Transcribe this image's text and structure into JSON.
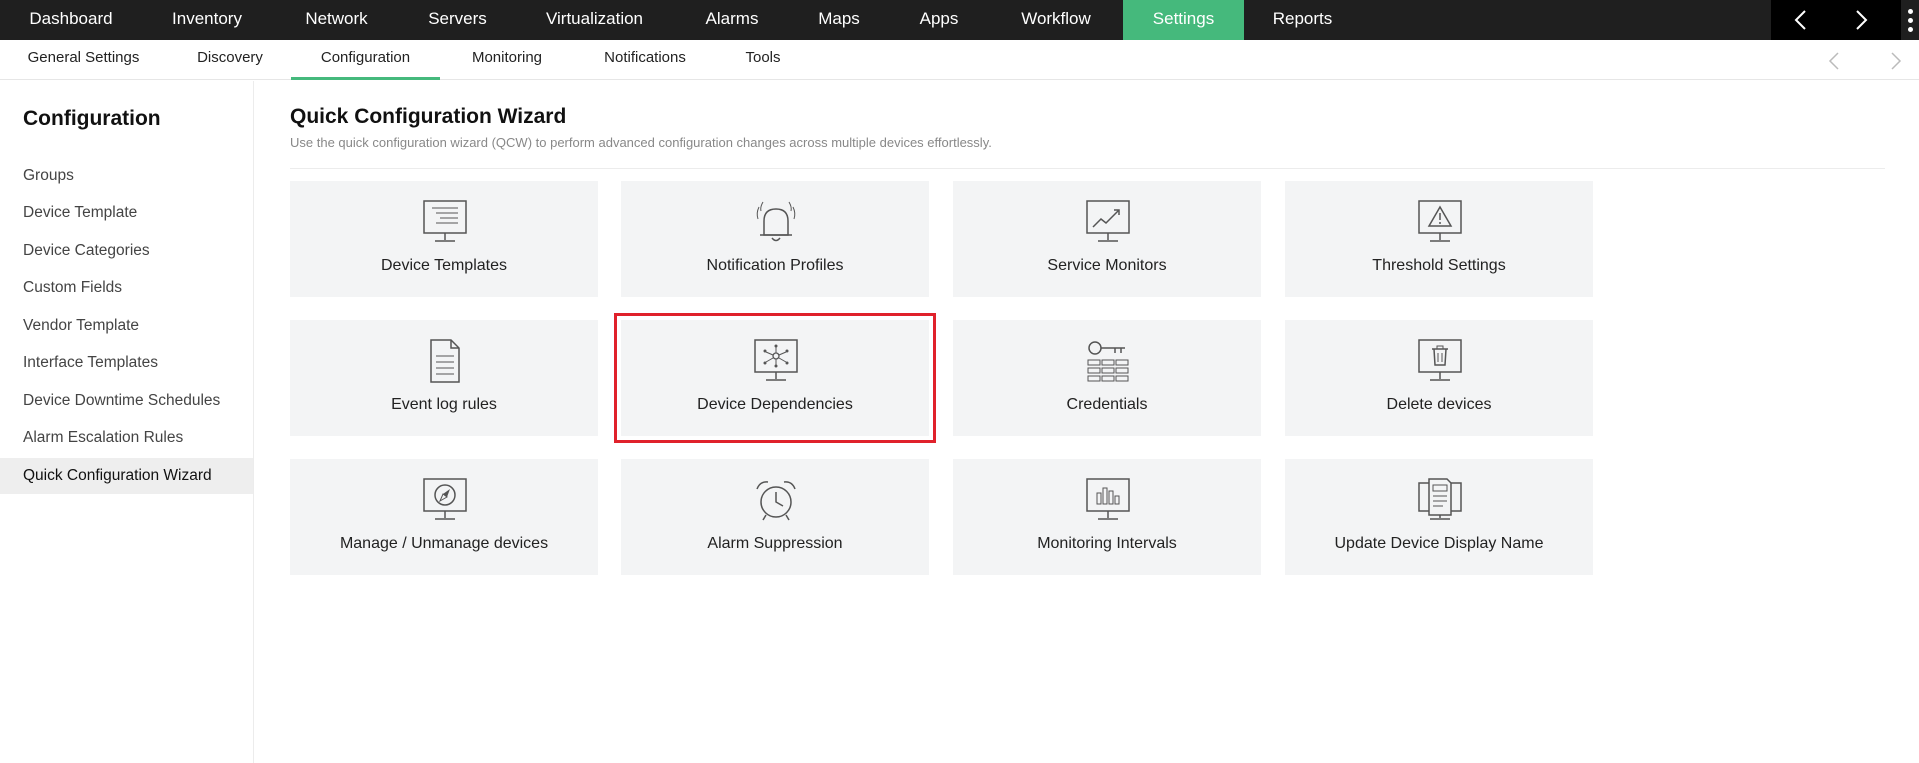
{
  "topnav": {
    "tabs": [
      "Dashboard",
      "Inventory",
      "Network",
      "Servers",
      "Virtualization",
      "Alarms",
      "Maps",
      "Apps",
      "Workflow",
      "Settings",
      "Reports"
    ],
    "active": "Settings"
  },
  "subnav": {
    "tabs": [
      "General Settings",
      "Discovery",
      "Configuration",
      "Monitoring",
      "Notifications",
      "Tools"
    ],
    "active": "Configuration"
  },
  "sidebar": {
    "heading": "Configuration",
    "items": [
      "Groups",
      "Device Template",
      "Device Categories",
      "Custom Fields",
      "Vendor Template",
      "Interface Templates",
      "Device Downtime Schedules",
      "Alarm Escalation Rules",
      "Quick Configuration Wizard"
    ],
    "active": "Quick Configuration Wizard"
  },
  "main": {
    "title": "Quick Configuration Wizard",
    "description": "Use the quick configuration wizard (QCW) to perform advanced configuration changes across multiple devices effortlessly.",
    "cards": [
      {
        "label": "Device Templates",
        "icon": "monitor-list-icon"
      },
      {
        "label": "Notification Profiles",
        "icon": "bell-icon"
      },
      {
        "label": "Service Monitors",
        "icon": "monitor-chart-icon"
      },
      {
        "label": "Threshold Settings",
        "icon": "monitor-warning-icon"
      },
      {
        "label": "Event log rules",
        "icon": "document-icon"
      },
      {
        "label": "Device Dependencies",
        "icon": "monitor-network-icon"
      },
      {
        "label": "Credentials",
        "icon": "key-icon"
      },
      {
        "label": "Delete devices",
        "icon": "monitor-trash-icon"
      },
      {
        "label": "Manage / Unmanage devices",
        "icon": "monitor-compass-icon"
      },
      {
        "label": "Alarm Suppression",
        "icon": "alarm-clock-icon"
      },
      {
        "label": "Monitoring Intervals",
        "icon": "monitor-bars-icon"
      },
      {
        "label": "Update Device Display Name",
        "icon": "monitor-doc-icon"
      }
    ],
    "highlighted": "Device Dependencies"
  },
  "colors": {
    "accent": "#45b97c",
    "topbar": "#1f1f1f",
    "highlight": "#e0212b",
    "card": "#f3f4f5"
  }
}
